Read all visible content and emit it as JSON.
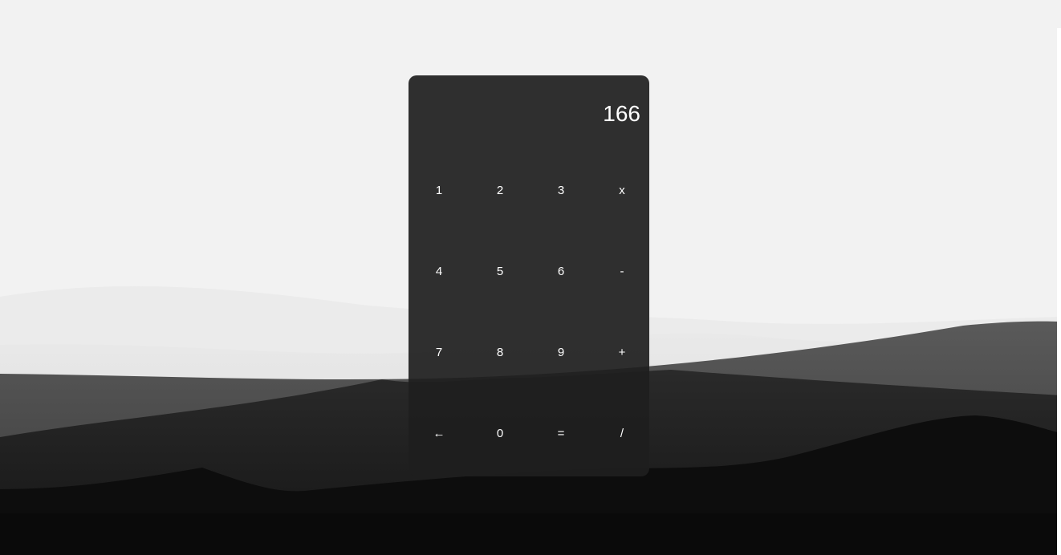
{
  "calculator": {
    "display_value": "166",
    "keys": [
      {
        "label": "1",
        "name": "key-1"
      },
      {
        "label": "2",
        "name": "key-2"
      },
      {
        "label": "3",
        "name": "key-3"
      },
      {
        "label": "x",
        "name": "key-multiply"
      },
      {
        "label": "4",
        "name": "key-4"
      },
      {
        "label": "5",
        "name": "key-5"
      },
      {
        "label": "6",
        "name": "key-6"
      },
      {
        "label": "-",
        "name": "key-subtract"
      },
      {
        "label": "7",
        "name": "key-7"
      },
      {
        "label": "8",
        "name": "key-8"
      },
      {
        "label": "9",
        "name": "key-9"
      },
      {
        "label": "+",
        "name": "key-add"
      },
      {
        "label": "←",
        "name": "key-backspace"
      },
      {
        "label": "0",
        "name": "key-0"
      },
      {
        "label": "=",
        "name": "key-equals"
      },
      {
        "label": "/",
        "name": "key-divide"
      }
    ]
  },
  "colors": {
    "page_background": "#f2f2f2",
    "calculator_panel": "#1e1e1e",
    "key_text": "#ffffff"
  }
}
